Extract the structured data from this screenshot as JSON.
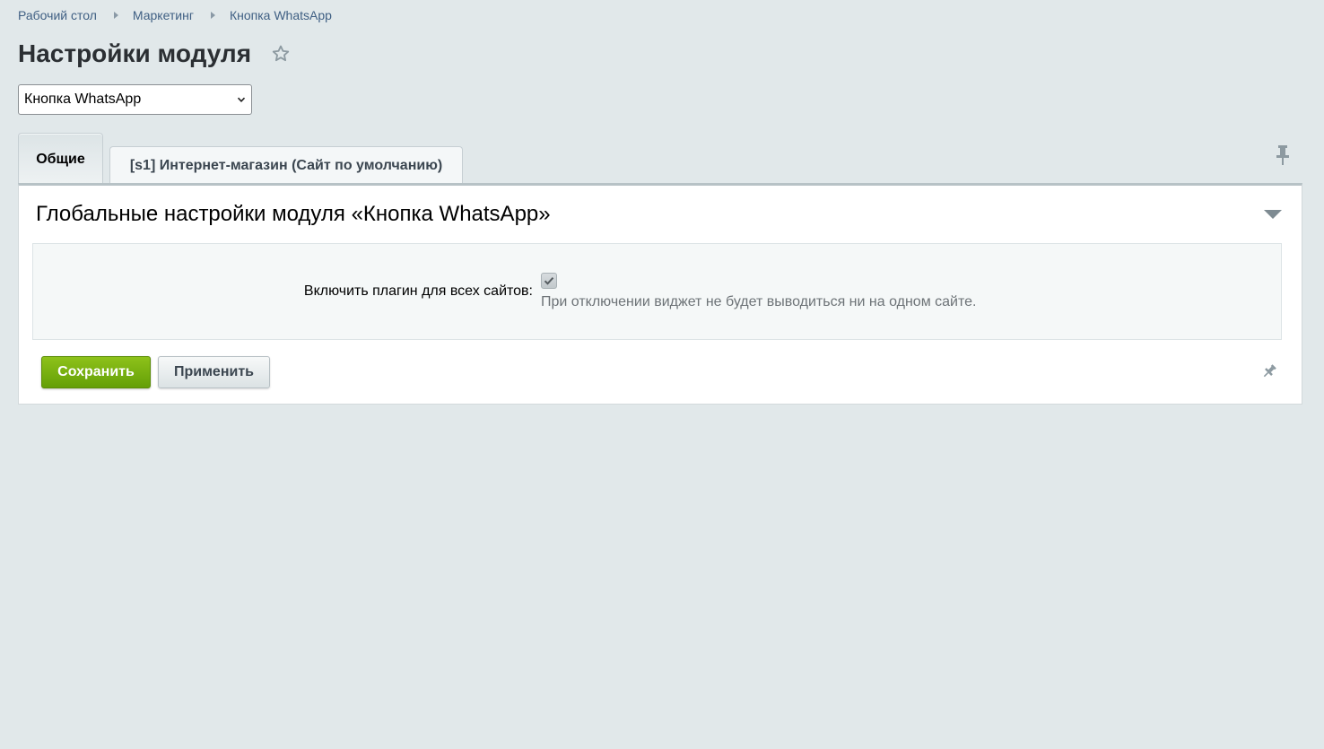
{
  "breadcrumbs": [
    {
      "label": "Рабочий стол"
    },
    {
      "label": "Маркетинг"
    },
    {
      "label": "Кнопка WhatsApp"
    }
  ],
  "page_title": "Настройки модуля",
  "module_select": {
    "value": "Кнопка WhatsApp"
  },
  "tabs": [
    {
      "label": "Общие",
      "active": true
    },
    {
      "label": "[s1] Интернет-магазин (Сайт по умолчанию)",
      "active": false
    }
  ],
  "section": {
    "title": "Глобальные настройки модуля «Кнопка WhatsApp»",
    "fields": [
      {
        "label": "Включить плагин для всех сайтов:",
        "checked": true,
        "hint": "При отключении виджет не будет выводиться ни на одном сайте."
      }
    ]
  },
  "buttons": {
    "save_label": "Сохранить",
    "apply_label": "Применить"
  },
  "colors": {
    "background": "#e1e8ea",
    "link": "#3f5f83",
    "save_button": "#7cb30f"
  },
  "icons": [
    "star-icon",
    "chevron-down-icon",
    "pin-icon",
    "collapse-icon",
    "checkmark-icon"
  ]
}
